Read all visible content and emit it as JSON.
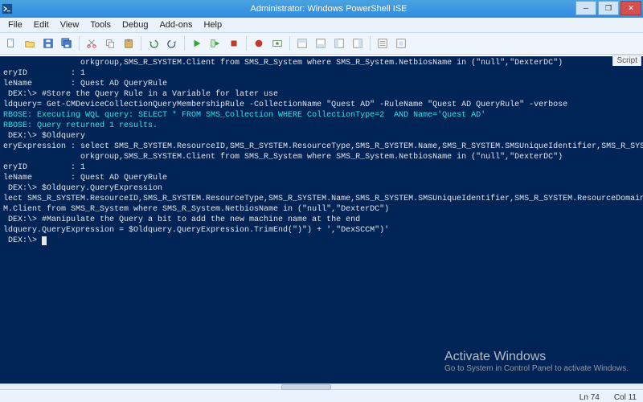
{
  "window": {
    "title": "Administrator: Windows PowerShell ISE",
    "min_icon": "─",
    "max_icon": "❐",
    "close_icon": "✕"
  },
  "menu": {
    "items": [
      "File",
      "Edit",
      "View",
      "Tools",
      "Debug",
      "Add-ons",
      "Help"
    ]
  },
  "toolbar_icons": {
    "new": "new-file",
    "open": "open-folder",
    "save": "save",
    "saveall": "save-all",
    "cut": "cut",
    "copy": "copy",
    "paste": "paste",
    "undo": "undo",
    "redo": "redo",
    "run": "play",
    "runsel": "play-selection",
    "stop": "stop",
    "bp": "breakpoint",
    "remote": "remote",
    "layout1": "layout-a",
    "layout2": "layout-b",
    "layout3": "layout-c",
    "layout4": "layout-d",
    "panel": "panel",
    "cmd": "cmd-addon"
  },
  "script_tab_label": "Script",
  "console_lines": [
    {
      "t": "                orkgroup,SMS_R_SYSTEM.Client from SMS_R_System where SMS_R_System.NetbiosName in (\"null\",\"DexterDC\")"
    },
    {
      "t": "eryID         : 1"
    },
    {
      "t": "leName        : Quest AD QueryRule"
    },
    {
      "t": ""
    },
    {
      "t": ""
    },
    {
      "t": ""
    },
    {
      "t": " DEX:\\> #Store the Query Rule in a Variable for later use"
    },
    {
      "t": "ldquery= Get-CMDeviceCollectionQueryMembershipRule -CollectionName \"Quest AD\" -RuleName \"Quest AD QueryRule\" -verbose"
    },
    {
      "t": "RBOSE: Executing WQL query: SELECT * FROM SMS_Collection WHERE CollectionType=2  AND Name='Quest AD'",
      "cls": "cyan"
    },
    {
      "t": "RBOSE: Query returned 1 results.",
      "cls": "cyan"
    },
    {
      "t": ""
    },
    {
      "t": " DEX:\\> $Oldquery"
    },
    {
      "t": ""
    },
    {
      "t": ""
    },
    {
      "t": "eryExpression : select SMS_R_SYSTEM.ResourceID,SMS_R_SYSTEM.ResourceType,SMS_R_SYSTEM.Name,SMS_R_SYSTEM.SMSUniqueIdentifier,SMS_R_SYSTEM.ResourceDomainORW"
    },
    {
      "t": "                orkgroup,SMS_R_SYSTEM.Client from SMS_R_System where SMS_R_System.NetbiosName in (\"null\",\"DexterDC\")"
    },
    {
      "t": "eryID         : 1"
    },
    {
      "t": "leName        : Quest AD QueryRule"
    },
    {
      "t": ""
    },
    {
      "t": ""
    },
    {
      "t": ""
    },
    {
      "t": " DEX:\\> $Oldquery.QueryExpression"
    },
    {
      "t": "lect SMS_R_SYSTEM.ResourceID,SMS_R_SYSTEM.ResourceType,SMS_R_SYSTEM.Name,SMS_R_SYSTEM.SMSUniqueIdentifier,SMS_R_SYSTEM.ResourceDomainORWorkgroup,SMS_R_SYS"
    },
    {
      "t": "M.Client from SMS_R_System where SMS_R_System.NetbiosName in (\"null\",\"DexterDC\")"
    },
    {
      "t": ""
    },
    {
      "t": " DEX:\\> #Manipulate the Query a bit to add the new machine name at the end"
    },
    {
      "t": "ldquery.QueryExpression = $Oldquery.QueryExpression.TrimEnd(\")\") + ',\"DexSCCM\")'"
    },
    {
      "t": ""
    },
    {
      "t": " DEX:\\> ",
      "caret": true
    }
  ],
  "watermark": {
    "big": "Activate Windows",
    "small": "Go to System in Control Panel to activate Windows."
  },
  "status": {
    "line": "Ln 74",
    "col": "Col 11"
  },
  "colors": {
    "console_bg": "#012456",
    "console_fg": "#e6e6e6",
    "verbose": "#2ee6e6",
    "title_grad_a": "#4aa3df",
    "title_grad_b": "#2f8be0"
  }
}
